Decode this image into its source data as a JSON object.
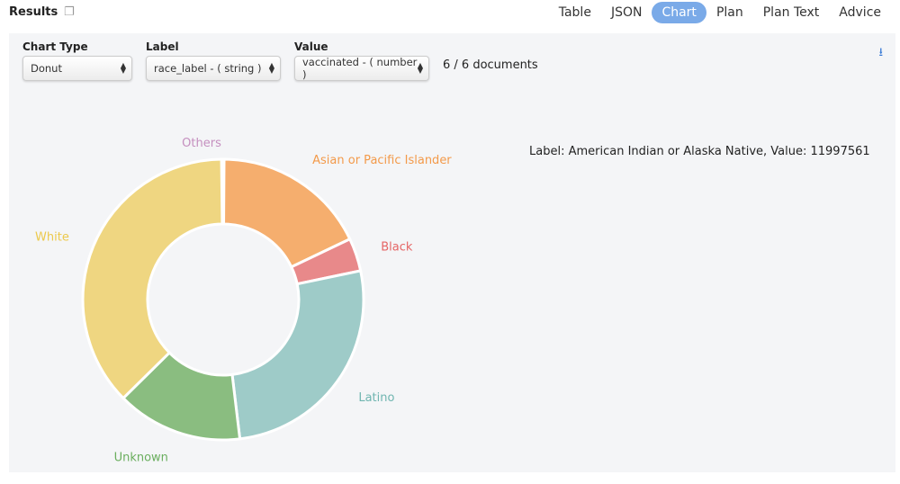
{
  "header": {
    "title": "Results",
    "copy_icon": "copy-icon"
  },
  "tabs": [
    {
      "label": "Table"
    },
    {
      "label": "JSON"
    },
    {
      "label": "Chart",
      "active": true
    },
    {
      "label": "Plan"
    },
    {
      "label": "Plan Text"
    },
    {
      "label": "Advice"
    }
  ],
  "controls": {
    "chart_type": {
      "label": "Chart Type",
      "value": "Donut"
    },
    "label": {
      "label": "Label",
      "value": "race_label - ( string )"
    },
    "value": {
      "label": "Value",
      "value": "vaccinated - ( number )"
    },
    "doc_count": "6 / 6 documents"
  },
  "hover_text": "Label: American Indian or Alaska Native, Value: 11997561",
  "chart_data": {
    "type": "pie",
    "variant": "donut",
    "value_unit": "percent share (estimated)",
    "slices": [
      {
        "label": "Others",
        "value": 0.3,
        "color": "#c58fbf"
      },
      {
        "label": "Asian or Pacific Islander",
        "value": 17.8,
        "color": "#f5ae6e"
      },
      {
        "label": "Black",
        "value": 3.8,
        "color": "#e8898a"
      },
      {
        "label": "Latino",
        "value": 26.4,
        "color": "#9ecbc8"
      },
      {
        "label": "Unknown",
        "value": 14.5,
        "color": "#8abd80"
      },
      {
        "label": "White",
        "value": 37.2,
        "color": "#efd681"
      }
    ],
    "label_colors": {
      "Others": "#c58fbf",
      "Asian or Pacific Islander": "#f39a4a",
      "Black": "#e56565",
      "Latino": "#6fb5b0",
      "Unknown": "#6aae5e",
      "White": "#ecc94b"
    }
  }
}
